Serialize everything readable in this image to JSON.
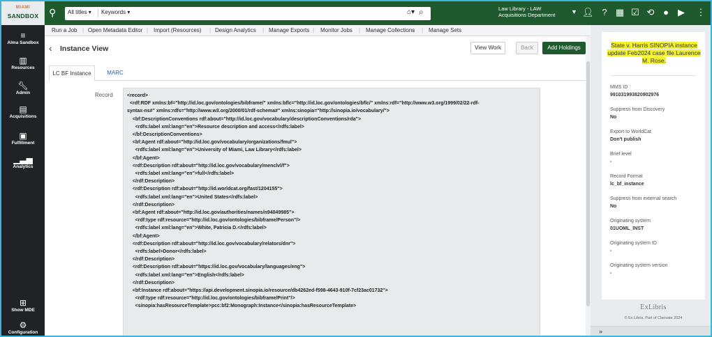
{
  "brand": {
    "top": "MIAMI",
    "name": "SANDBOX"
  },
  "search": {
    "scope": "All titles ▾",
    "field": "Keywords ▾"
  },
  "library": {
    "line1": "Law Library - LAW",
    "line2": "Acquisitions Department"
  },
  "leftnav": {
    "alma": "Alma Sandbox",
    "resources": "Resources",
    "admin": "Admin",
    "acquisitions": "Acquisitions",
    "fulfillment": "Fulfillment",
    "analytics": "Analytics",
    "showmde": "Show MDE",
    "configuration": "Configuration"
  },
  "actions": [
    "Run a Job",
    "Open Metadata Editor",
    "Import (Resources)",
    "Design Analytics",
    "Manage Exports",
    "Monitor Jobs",
    "Manage Collections",
    "Manage Sets"
  ],
  "page": {
    "title": "Instance View",
    "view_work": "View Work",
    "back": "Back",
    "add_holdings": "Add Holdings"
  },
  "tabs": [
    "LC BF Instance",
    "MARC"
  ],
  "record_label": "Record",
  "code_lines": [
    "<record>",
    "  <rdf:RDF xmlns:bf=\"http://id.loc.gov/ontologies/bibframe/\" xmlns:bflc=\"http://id.loc.gov/ontologies/bflc/\" xmlns:rdf=\"http://www.w3.org/1999/02/22-rdf-",
    "syntax-ns#\" xmlns:rdfs=\"http://www.w3.org/2000/01/rdf-schema#\" xmlns:sinopia=\"http://sinopia.io/vocabulary/\">",
    "    <bf:DescriptionConventions rdf:about=\"http://id.loc.gov/vocabulary/descriptionConventions/rda\">",
    "      <rdfs:label xml:lang=\"en\">Resource description and access</rdfs:label>",
    "    </bf:DescriptionConventions>",
    "    <bf:Agent rdf:about=\"http://id.loc.gov/vocabulary/organizations/fmul\">",
    "      <rdfs:label xml:lang=\"en\">University of Miami, Law Library</rdfs:label>",
    "    </bf:Agent>",
    "    <rdf:Description rdf:about=\"http://id.loc.gov/vocabulary/menclvl/f\">",
    "      <rdfs:label xml:lang=\"en\">full</rdfs:label>",
    "    </rdf:Description>",
    "    <rdf:Description rdf:about=\"http://id.worldcat.org/fast/1204155\">",
    "      <rdfs:label xml:lang=\"en\">United States</rdfs:label>",
    "    </rdf:Description>",
    "    <bf:Agent rdf:about=\"http://id.loc.gov/authorities/names/n94049985\">",
    "      <rdf:type rdf:resource=\"http://id.loc.gov/ontologies/bibframe/Person\"/>",
    "      <rdfs:label xml:lang=\"en\">White, Patricia D.</rdfs:label>",
    "    </bf:Agent>",
    "    <rdf:Description rdf:about=\"http://id.loc.gov/vocabulary/relators/dnr\">",
    "      <rdfs:label>Donor</rdfs:label>",
    "    </rdf:Description>",
    "    <rdf:Description rdf:about=\"https://id.loc.gov/vocabulary/languages/eng\">",
    "      <rdfs:label xml:lang=\"en\">English</rdfs:label>",
    "    </rdf:Description>",
    "    <bf:Instance rdf:about=\"https://api.development.sinopia.io/resource/db4262ed-f598-4643-910f-7cf23ac01732\">",
    "      <rdf:type rdf:resource=\"http://id.loc.gov/ontologies/bibframe/Print\"/>",
    "      <sinopia:hasResourceTemplate>pcc:bf2:Monograph:Instance</sinopia:hasResourceTemplate>"
  ],
  "right": {
    "title": "State v. Harris SINOPIA instance update Feb2024 case file Laurence M. Rose.",
    "fields": [
      {
        "label": "MMS ID",
        "value": "991031993820902976"
      },
      {
        "label": "Suppress from Discovery",
        "value": "No"
      },
      {
        "label": "Export to WorldCat",
        "value": "Don't publish"
      },
      {
        "label": "Brief level",
        "value": "-"
      },
      {
        "label": "Record Format",
        "value": "lc_bf_instance"
      },
      {
        "label": "Suppress from external search",
        "value": "No"
      },
      {
        "label": "Originating system",
        "value": "01UOML_INST"
      },
      {
        "label": "Originating system ID",
        "value": "-"
      },
      {
        "label": "Originating system version",
        "value": "-"
      }
    ],
    "logo": "ExLibris",
    "copyright": "© Ex Libris, Part of Clarivate   2024"
  }
}
